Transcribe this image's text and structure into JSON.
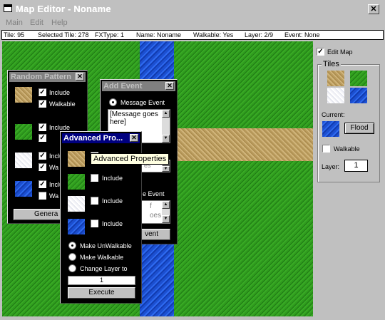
{
  "window": {
    "title": "Map Editor - Noname"
  },
  "menu": [
    "Main",
    "Edit",
    "Help"
  ],
  "status": {
    "tile": "Tile: 95",
    "selected": "Selected Tile: 278",
    "fxtype": "FXType: 1",
    "name": "Name: Noname",
    "walkable": "Walkable: Yes",
    "layer": "Layer: 2/9",
    "event": "Event: None"
  },
  "right_panel": {
    "edit_map_label": "Edit Map",
    "tiles_label": "Tiles",
    "current_label": "Current:",
    "flood_label": "Flood",
    "walkable_label": "Walkable",
    "layer_label": "Layer:",
    "layer_value": "1"
  },
  "random_pattern": {
    "title": "Random Pattern",
    "include": "Include",
    "walkable": "Walkable",
    "include_short": "Inclu",
    "walkable_short": "Wa",
    "generate": "Genera"
  },
  "add_event": {
    "title": "Add Event",
    "message_event": "Message Event",
    "message_text": "[Message goes here]",
    "frag_es": "es",
    "frag_e_event": "e Event",
    "frag_f": "f",
    "frag_goes": "oes",
    "button": "vent"
  },
  "advanced": {
    "title": "Advanced Pro...",
    "tooltip": "Advanced Properties",
    "include": "Include",
    "make_unwalkable": "Make UnWalkable",
    "make_walkable": "Make Walkable",
    "change_layer": "Change Layer to",
    "layer_value": "1",
    "execute": "Execute"
  },
  "icons": {
    "app": "window-icon",
    "close": "close-icon"
  }
}
